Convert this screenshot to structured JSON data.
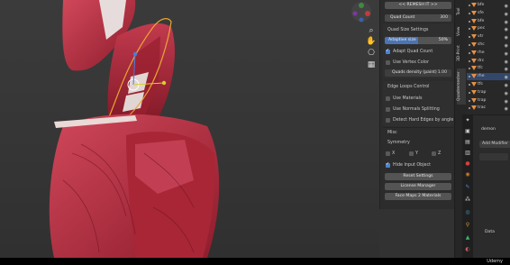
{
  "npanel": {
    "remesh_button": "<< REMESH IT >>",
    "quad_count_label": "Quad Count",
    "quad_count_value": "300",
    "quad_size_header": "Quad Size Settings",
    "adaptive_label": "Adaptive size",
    "adaptive_value": "50%",
    "adaptive_fraction": 0.5,
    "adapt_quad_count": "Adapt Quad Count",
    "use_vertex_color": "Use Vertex Color",
    "quads_density_label": "Quads density (paint)",
    "quads_density_value": "1.00",
    "edge_loops_header": "Edge Loops Control",
    "use_materials": "Use Materials",
    "use_normals_splitting": "Use Normals Splitting",
    "detect_hard_edges": "Detect Hard Edges by angle",
    "misc_header": "Misc",
    "symmetry_label": "Symmetry",
    "sym_x": "X",
    "sym_y": "Y",
    "sym_z": "Z",
    "hide_input_object": "Hide Input Object",
    "reset_settings": "Reset Settings",
    "license_manager": "License Manager",
    "face_maps_to_materials": "Face Maps 2 Materials"
  },
  "vtabs": [
    "Tool",
    "View",
    "3D-Print",
    "Quadremesher"
  ],
  "outliner": {
    "rows": [
      "bfe",
      "sfe",
      "bfe",
      "pec",
      "vtr",
      "shc",
      "rhe",
      "drc",
      "tfc",
      "rhe",
      "tfs",
      "trap",
      "trap",
      "trac"
    ],
    "selected_index": 9
  },
  "properties": {
    "object_name": "demon",
    "add_modifier": "Add Modifier",
    "data_label": "Data"
  },
  "watermark": "Udemy",
  "colors": {
    "accent": "#4a74b3",
    "checkbox_on": "#4b83d0",
    "muscle": "#b0283a",
    "outliner_icon": "#e59044",
    "selection": "#e8a530"
  }
}
